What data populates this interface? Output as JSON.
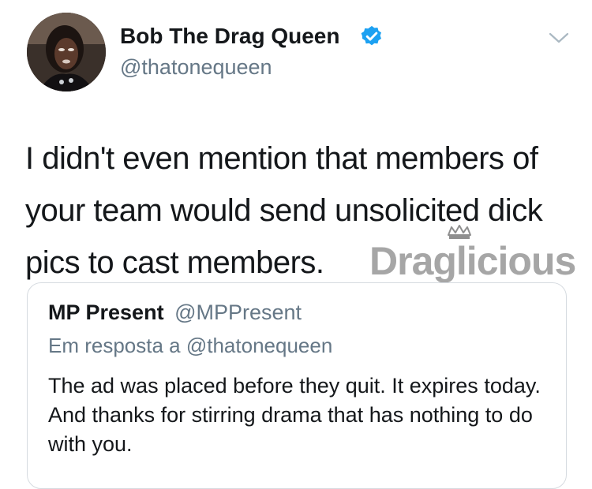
{
  "tweet": {
    "display_name": "Bob The Drag Queen",
    "handle": "@thatonequeen",
    "verified": true,
    "body_lines": [
      "I didn't even mention that members of",
      "your team would send unsolicited dick",
      "pics to cast members."
    ]
  },
  "watermark": {
    "text": "Draglicious"
  },
  "quoted_tweet": {
    "display_name": "MP Present",
    "handle": "@MPPresent",
    "reply_context": "Em resposta a @thatonequeen",
    "text": "The ad was placed before they quit. It expires today. And thanks for stirring drama that has nothing to do with you."
  },
  "icons": [
    "avatar",
    "verified-badge-icon",
    "chevron-down-icon",
    "crown-icon"
  ],
  "colors": {
    "verified": "#1DA1F2",
    "secondary_text": "#657786",
    "watermark": "#a6a6a6"
  }
}
